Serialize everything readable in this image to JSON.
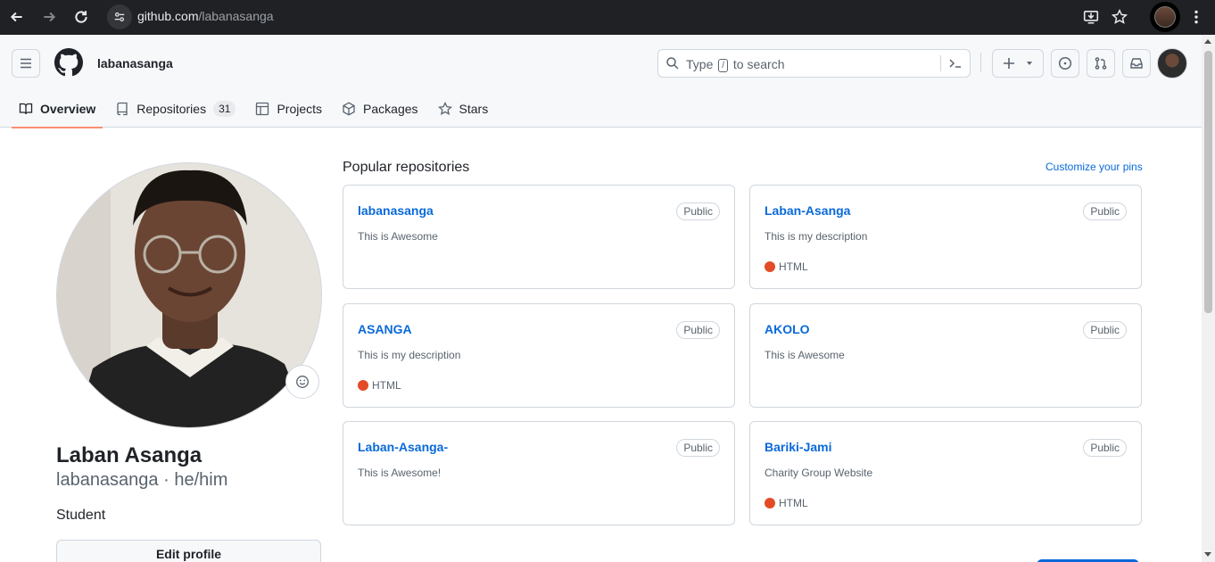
{
  "browser": {
    "url_host": "github.com",
    "url_path": "/labanasanga"
  },
  "header": {
    "username": "labanasanga",
    "search": {
      "prefix": "Type",
      "key": "/",
      "suffix": "to search"
    }
  },
  "tabs": [
    {
      "label": "Overview",
      "icon": "book-icon",
      "selected": true
    },
    {
      "label": "Repositories",
      "icon": "repo-icon",
      "count": "31"
    },
    {
      "label": "Projects",
      "icon": "table-icon"
    },
    {
      "label": "Packages",
      "icon": "package-icon"
    },
    {
      "label": "Stars",
      "icon": "star-icon"
    }
  ],
  "profile": {
    "name": "Laban Asanga",
    "login_line": "labanasanga · he/him",
    "bio": "Student",
    "edit_label": "Edit profile"
  },
  "popular": {
    "title": "Popular repositories",
    "customize_label": "Customize your pins",
    "repos": [
      {
        "name": "labanasanga",
        "visibility": "Public",
        "description": "This is Awesome",
        "language": ""
      },
      {
        "name": "Laban-Asanga",
        "visibility": "Public",
        "description": "This is my description",
        "language": "HTML"
      },
      {
        "name": "ASANGA",
        "visibility": "Public",
        "description": "This is my description",
        "language": "HTML"
      },
      {
        "name": "AKOLO",
        "visibility": "Public",
        "description": "This is Awesome",
        "language": ""
      },
      {
        "name": "Laban-Asanga-",
        "visibility": "Public",
        "description": "This is Awesome!",
        "language": ""
      },
      {
        "name": "Bariki-Jami",
        "visibility": "Public",
        "description": "Charity Group Website",
        "language": "HTML"
      }
    ]
  },
  "colors": {
    "accent": "#0969da",
    "tab_underline": "#fd8c73",
    "html_language": "#e34c26"
  }
}
